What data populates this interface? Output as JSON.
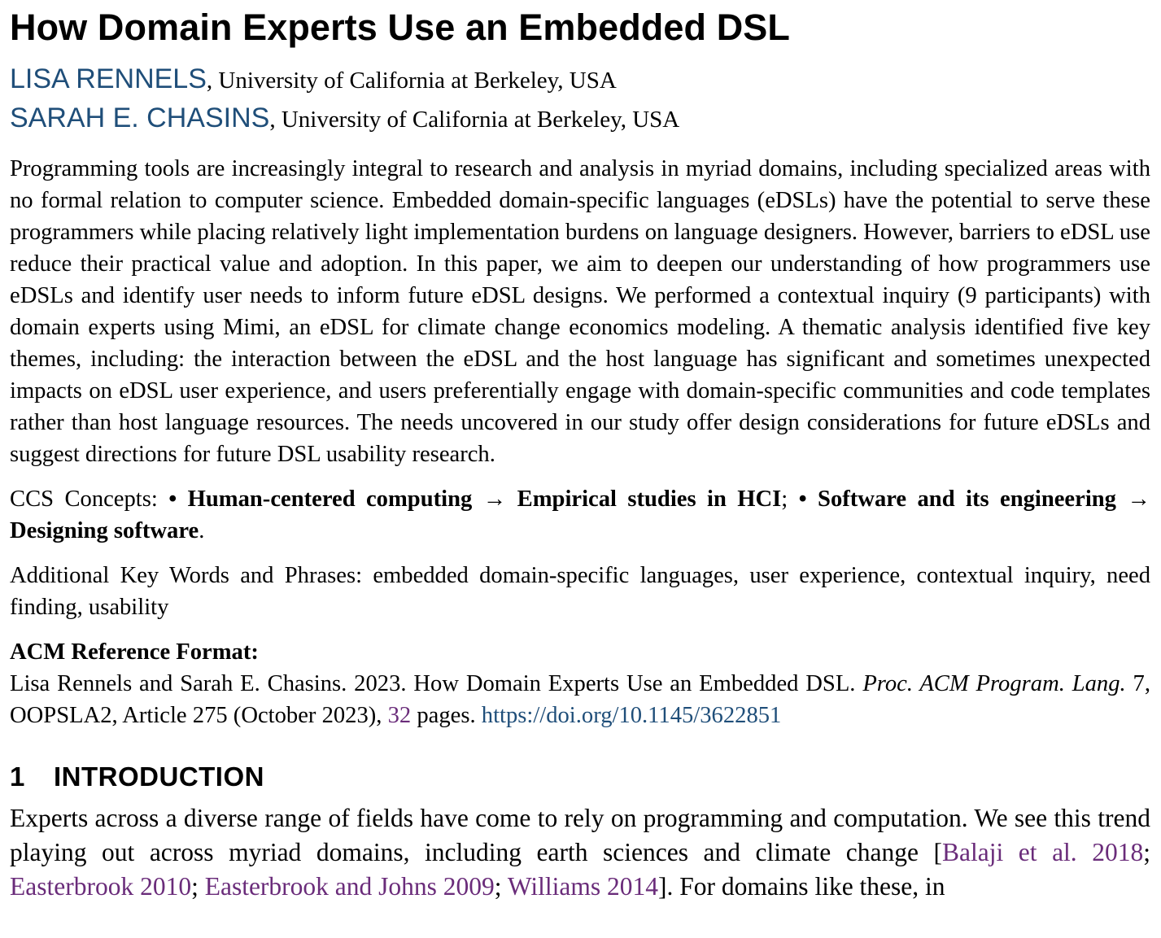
{
  "paper": {
    "title": "How Domain Experts Use an Embedded DSL",
    "authors": [
      {
        "name": "LISA RENNELS",
        "sep": ",",
        "affiliation": "University of California at Berkeley, USA"
      },
      {
        "name": "SARAH E. CHASINS",
        "sep": ",",
        "affiliation": "University of California at Berkeley, USA"
      }
    ],
    "abstract": "Programming tools are increasingly integral to research and analysis in myriad domains, including specialized areas with no formal relation to computer science. Embedded domain-specific languages (eDSLs) have the potential to serve these programmers while placing relatively light implementation burdens on language designers. However, barriers to eDSL use reduce their practical value and adoption. In this paper, we aim to deepen our understanding of how programmers use eDSLs and identify user needs to inform future eDSL designs. We performed a contextual inquiry (9 participants) with domain experts using Mimi, an eDSL for climate change economics modeling. A thematic analysis identified five key themes, including: the interaction between the eDSL and the host language has significant and sometimes unexpected impacts on eDSL user experience, and users preferentially engage with domain-specific communities and code templates rather than host language resources. The needs uncovered in our study offer design considerations for future eDSLs and suggest directions for future DSL usability research.",
    "ccs": {
      "label": "CCS Concepts:",
      "bullet1": "•",
      "concept1": "Human-centered computing → Empirical studies in HCI",
      "sep": ";",
      "bullet2": "•",
      "concept2": "Software and its engi­neering → Designing software",
      "end": "."
    },
    "keywords": {
      "label": "Additional Key Words and Phrases:",
      "text": "embedded domain-specific languages, user experience, contextual inquiry, need finding, usability"
    },
    "reference": {
      "heading": "ACM Reference Format:",
      "text_a": "Lisa Rennels and Sarah E. Chasins. 2023. How Domain Experts Use an Embedded DSL.",
      "venue": "Proc. ACM Program. Lang.",
      "text_b": "7, OOPSLA2, Article 275 (October 2023),",
      "pages": "32",
      "text_c": "pages.",
      "doi": "https://doi.org/10.1145/3622851"
    },
    "section": {
      "number": "1",
      "title": "INTRODUCTION"
    },
    "intro": {
      "text_a": "Experts across a diverse range of fields have come to rely on programming and computation. We see this trend playing out across myriad domains, including earth sciences and climate change [",
      "cite1": "Balaji et al. 2018",
      "semi1": "; ",
      "cite2": "Easterbrook 2010",
      "semi2": "; ",
      "cite3": "Easterbrook and Johns 2009",
      "semi3": "; ",
      "cite4": "Williams 2014",
      "text_b": "]. For domains like these, in"
    }
  }
}
